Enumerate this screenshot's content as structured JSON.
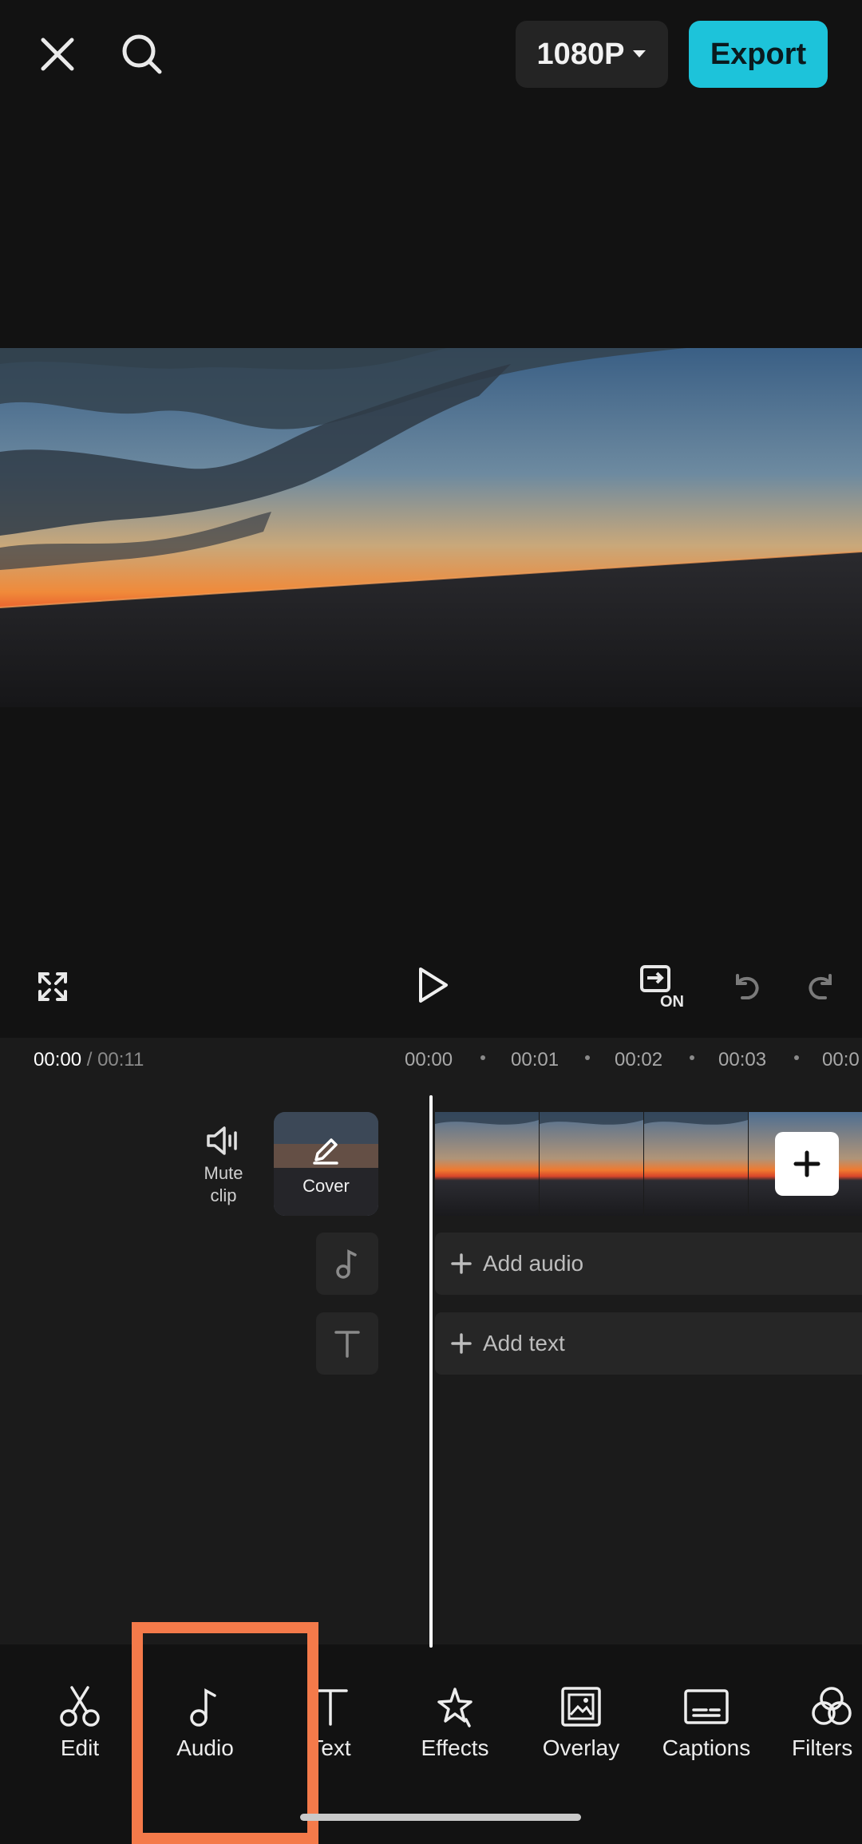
{
  "topbar": {
    "resolution": "1080P",
    "export_label": "Export"
  },
  "controls": {
    "icons": [
      "fullscreen-icon",
      "play-icon",
      "keyframe-on-icon",
      "undo-icon",
      "redo-icon"
    ],
    "keyframe_badge": "ON"
  },
  "timeline": {
    "current_time": "00:00",
    "total_time": "/ 00:11",
    "ruler": [
      "00:00",
      "00:01",
      "00:02",
      "00:03",
      "00:0"
    ],
    "mute_label_line1": "Mute",
    "mute_label_line2": "clip",
    "cover_label": "Cover",
    "add_audio_label": "Add audio",
    "add_text_label": "Add text"
  },
  "toolbar": {
    "items": [
      {
        "label": "Edit",
        "icon": "scissors-icon"
      },
      {
        "label": "Audio",
        "icon": "music-note-icon"
      },
      {
        "label": "Text",
        "icon": "text-icon"
      },
      {
        "label": "Effects",
        "icon": "star-sparkle-icon"
      },
      {
        "label": "Overlay",
        "icon": "overlay-icon"
      },
      {
        "label": "Captions",
        "icon": "captions-icon"
      },
      {
        "label": "Filters",
        "icon": "filters-icon"
      }
    ],
    "highlighted": "Audio"
  },
  "colors": {
    "background": "#121212",
    "accent": "#1dc3da",
    "highlight": "#f47a4a"
  }
}
